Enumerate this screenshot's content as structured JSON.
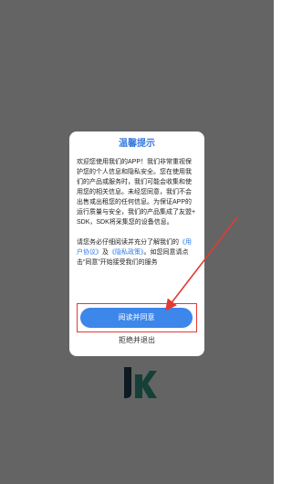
{
  "dialog": {
    "title": "温馨提示",
    "paragraph1": "欢迎您使用我们的APP！我们非常重视保护您的个人信息和隐私安全。您在使用我们的产品或服务时，我们可能会收集和使用您的相关信息。未经您同意，我们不会出售或出租您的任何信息。为保证APP的运行质量与安全，我们的产品集成了友盟+SDK，SDK将采集您的设备信息。",
    "paragraph2_prefix": "请您务必仔细阅读并充分了解我们的",
    "user_agreement_link": "《用户协议》",
    "conjunction": "及",
    "privacy_policy_link": "《隐私政策》",
    "paragraph2_suffix": "。如您同意请点击“同意”开始接受我们的服务",
    "agree_button_label": "阅读并同意",
    "reject_label": "拒绝并退出"
  },
  "colors": {
    "accent": "#3d86ea",
    "title": "#3a7be0",
    "annotation": "#e53935"
  },
  "background": {
    "logo": "jk-logo"
  }
}
